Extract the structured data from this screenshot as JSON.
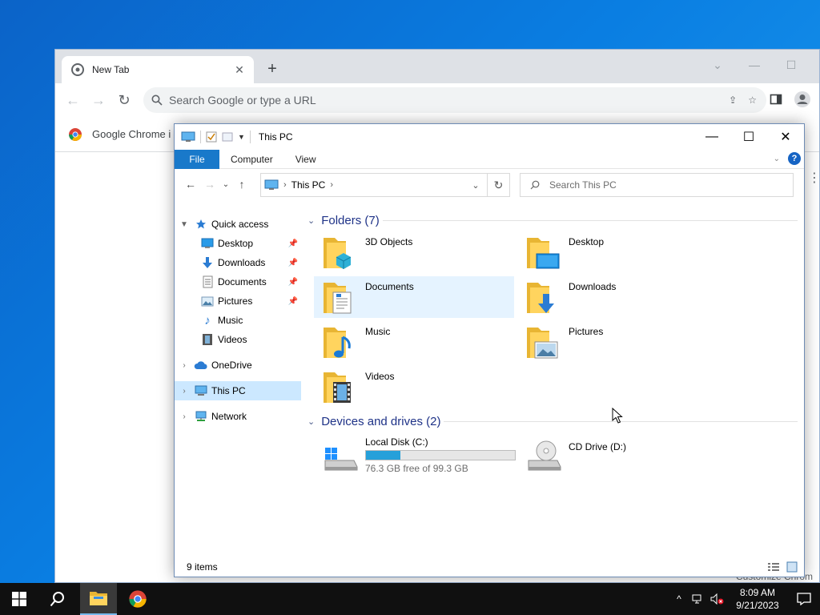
{
  "chrome": {
    "tab_title": "New Tab",
    "omnibox_placeholder": "Search Google or type a URL",
    "bookmark_text": "Google Chrome i",
    "customize_text": "Customize Chrom"
  },
  "explorer": {
    "title": "This PC",
    "ribbon": {
      "file": "File",
      "computer": "Computer",
      "view": "View",
      "help": "?"
    },
    "address": {
      "location": "This PC"
    },
    "search_placeholder": "Search This PC",
    "nav": {
      "quick_access": "Quick access",
      "desktop": "Desktop",
      "downloads": "Downloads",
      "documents": "Documents",
      "pictures": "Pictures",
      "music": "Music",
      "videos": "Videos",
      "onedrive": "OneDrive",
      "this_pc": "This PC",
      "network": "Network"
    },
    "folders_header": "Folders (7)",
    "folders": {
      "objects3d": "3D Objects",
      "desktop": "Desktop",
      "documents": "Documents",
      "downloads": "Downloads",
      "music": "Music",
      "pictures": "Pictures",
      "videos": "Videos"
    },
    "devices_header": "Devices and drives (2)",
    "drives": {
      "c_name": "Local Disk (C:)",
      "c_free": "76.3 GB free of 99.3 GB",
      "c_used_fraction": 0.231,
      "d_name": "CD Drive (D:)"
    },
    "status": "9 items"
  },
  "taskbar": {
    "time": "8:09 AM",
    "date": "9/21/2023"
  },
  "colors": {
    "accent": "#1979ca",
    "selection": "#cce8ff",
    "hover": "#e5f3ff",
    "group_header": "#1e3287",
    "drive_bar": "#26a0da"
  }
}
